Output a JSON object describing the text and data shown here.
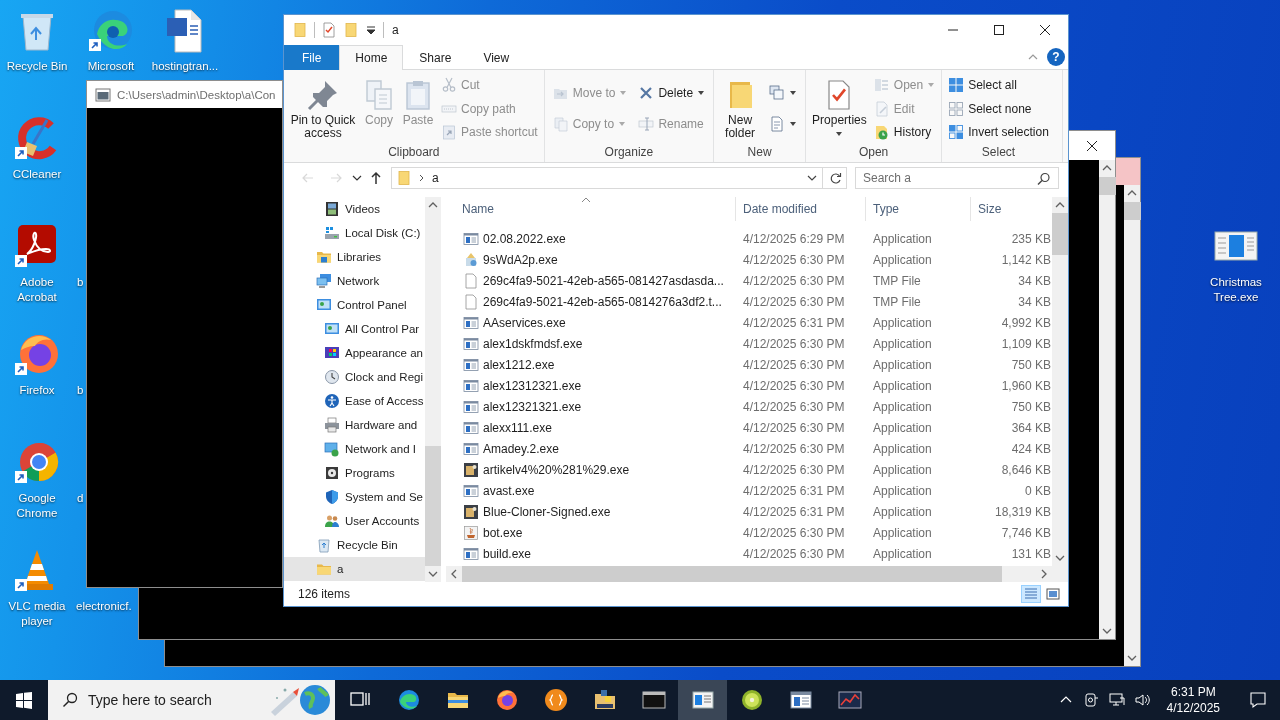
{
  "desktop_icons": [
    {
      "label": "Recycle Bin",
      "kind": "recycle-bin",
      "shortcut": false
    },
    {
      "label": "Microsoft",
      "kind": "edge",
      "shortcut": true
    },
    {
      "label": "hostingtran...",
      "kind": "document",
      "shortcut": false
    },
    {
      "label": "CCleaner",
      "kind": "cleaner",
      "shortcut": true
    },
    {
      "label": "Adobe Acrobat",
      "kind": "acrobat",
      "shortcut": true
    },
    {
      "label": "b",
      "kind": "hidden"
    },
    {
      "label": "Firefox",
      "kind": "firefox",
      "shortcut": true
    },
    {
      "label": "b",
      "kind": "hidden"
    },
    {
      "label": "Google Chrome",
      "kind": "chrome",
      "shortcut": true
    },
    {
      "label": "d",
      "kind": "hidden"
    },
    {
      "label": "VLC media player",
      "kind": "vlc",
      "shortcut": true
    },
    {
      "label": "electronicf.",
      "kind": "hidden"
    },
    {
      "label": "Christmas Tree.exe",
      "kind": "app-window",
      "shortcut": false
    }
  ],
  "console_windows": [
    {
      "kind": "titled",
      "title": "C:\\Users\\admin\\Desktop\\a\\Con"
    },
    {
      "kind": "closable"
    },
    {
      "kind": "tinted"
    }
  ],
  "explorer": {
    "title": "a",
    "help": "?",
    "ribbon_tabs": [
      {
        "label": "File",
        "kind": "file",
        "selected": false
      },
      {
        "label": "Home",
        "kind": "tab",
        "selected": true
      },
      {
        "label": "Share",
        "kind": "tab",
        "selected": false
      },
      {
        "label": "View",
        "kind": "tab",
        "selected": false
      }
    ],
    "ribbon_groups": [
      {
        "label": "Clipboard",
        "columns": [
          {
            "kind": "large",
            "commands": [
              {
                "kind": "pin",
                "label": "Pin to Quick access",
                "disabled": false,
                "dropdown": false
              }
            ]
          },
          {
            "kind": "large",
            "commands": [
              {
                "kind": "copy",
                "label": "Copy",
                "disabled": true,
                "dropdown": false
              }
            ]
          },
          {
            "kind": "large",
            "commands": [
              {
                "kind": "paste",
                "label": "Paste",
                "disabled": true,
                "dropdown": false
              }
            ]
          },
          {
            "kind": "stack",
            "commands": [
              {
                "kind": "cut",
                "label": "Cut",
                "disabled": true,
                "dropdown": false
              },
              {
                "kind": "copy-path",
                "label": "Copy path",
                "disabled": true,
                "dropdown": false
              },
              {
                "kind": "paste-shortcut",
                "label": "Paste shortcut",
                "disabled": true,
                "dropdown": false
              }
            ]
          }
        ]
      },
      {
        "label": "Organize",
        "columns": [
          {
            "kind": "stack",
            "commands": [
              {
                "kind": "move-to",
                "label": "Move to",
                "disabled": true,
                "dropdown": true
              },
              {
                "kind": "copy-to",
                "label": "Copy to",
                "disabled": true,
                "dropdown": true
              }
            ]
          },
          {
            "kind": "stack",
            "commands": [
              {
                "kind": "delete",
                "label": "Delete",
                "disabled": false,
                "dropdown": true
              },
              {
                "kind": "rename",
                "label": "Rename",
                "disabled": true,
                "dropdown": false
              }
            ]
          }
        ]
      },
      {
        "label": "New",
        "columns": [
          {
            "kind": "large",
            "commands": [
              {
                "kind": "new-folder",
                "label": "New folder",
                "disabled": false,
                "dropdown": false
              }
            ]
          },
          {
            "kind": "stack",
            "commands": [
              {
                "kind": "new-item",
                "disabled": false,
                "dropdown": true
              },
              {
                "kind": "easy-access",
                "disabled": false,
                "dropdown": true
              }
            ]
          }
        ]
      },
      {
        "label": "Open",
        "columns": [
          {
            "kind": "large",
            "commands": [
              {
                "kind": "properties",
                "label": "Properties",
                "disabled": false,
                "dropdown": true
              }
            ]
          },
          {
            "kind": "stack",
            "commands": [
              {
                "kind": "open",
                "label": "Open",
                "disabled": true,
                "dropdown": true
              },
              {
                "kind": "edit",
                "label": "Edit",
                "disabled": true,
                "dropdown": false
              },
              {
                "kind": "history",
                "label": "History",
                "disabled": false,
                "dropdown": false
              }
            ]
          }
        ]
      },
      {
        "label": "Select",
        "columns": [
          {
            "kind": "stack",
            "commands": [
              {
                "kind": "select-all",
                "label": "Select all",
                "disabled": false,
                "dropdown": false
              },
              {
                "kind": "select-none",
                "label": "Select none",
                "disabled": false,
                "dropdown": false
              },
              {
                "kind": "invert-selection",
                "label": "Invert selection",
                "disabled": false,
                "dropdown": false
              }
            ]
          }
        ]
      }
    ],
    "nav_buttons": [
      {
        "kind": "back",
        "disabled": true
      },
      {
        "kind": "forward",
        "disabled": true
      },
      {
        "kind": "recent",
        "disabled": false
      },
      {
        "kind": "up",
        "disabled": false
      }
    ],
    "path": [
      "a"
    ],
    "search": {
      "placeholder": "Search a"
    },
    "navigation": [
      {
        "children": [
          {
            "label": "Videos",
            "kind": "videos",
            "selected": false
          },
          {
            "label": "Local Disk (C:)",
            "kind": "disk",
            "selected": false
          }
        ]
      },
      {
        "label": "Libraries",
        "kind": "libraries",
        "selected": false
      },
      {
        "label": "Network",
        "kind": "network",
        "selected": false
      },
      {
        "label": "Control Panel",
        "kind": "control-panel",
        "selected": false,
        "children": [
          {
            "label": "All Control Par",
            "kind": "control-panel",
            "selected": false
          },
          {
            "label": "Appearance an",
            "kind": "appearance",
            "selected": false
          },
          {
            "label": "Clock and Regi",
            "kind": "clock",
            "selected": false
          },
          {
            "label": "Ease of Access",
            "kind": "ease",
            "selected": false
          },
          {
            "label": "Hardware and",
            "kind": "hardware",
            "selected": false
          },
          {
            "label": "Network and I",
            "kind": "network-internet",
            "selected": false
          },
          {
            "label": "Programs",
            "kind": "programs",
            "selected": false
          },
          {
            "label": "System and Se",
            "kind": "system",
            "selected": false
          },
          {
            "label": "User Accounts",
            "kind": "users",
            "selected": false
          }
        ]
      },
      {
        "label": "Recycle Bin",
        "kind": "recycle",
        "selected": false
      },
      {
        "label": "a",
        "kind": "folder",
        "selected": true
      }
    ],
    "file_list": {
      "columns": [
        {
          "label": "Name",
          "sorted": true
        },
        {
          "label": "Date modified"
        },
        {
          "label": "Type"
        },
        {
          "label": "Size"
        }
      ],
      "rows": [
        {
          "name": "02.08.2022.exe",
          "date": "4/12/2025 6:29 PM",
          "type": "Application",
          "size": "235 KB",
          "kind": "app",
          "selected": false
        },
        {
          "name": "9sWdA2p.exe",
          "date": "4/12/2025 6:30 PM",
          "type": "Application",
          "size": "1,142 KB",
          "kind": "setup",
          "selected": false
        },
        {
          "name": "269c4fa9-5021-42eb-a565-081427asdasda...",
          "date": "4/12/2025 6:30 PM",
          "type": "TMP File",
          "size": "34 KB",
          "kind": "file",
          "selected": false
        },
        {
          "name": "269c4fa9-5021-42eb-a565-0814276a3df2.t...",
          "date": "4/12/2025 6:30 PM",
          "type": "TMP File",
          "size": "34 KB",
          "kind": "file",
          "selected": false
        },
        {
          "name": "AAservices.exe",
          "date": "4/12/2025 6:31 PM",
          "type": "Application",
          "size": "4,992 KB",
          "kind": "app",
          "selected": false
        },
        {
          "name": "alex1dskfmdsf.exe",
          "date": "4/12/2025 6:30 PM",
          "type": "Application",
          "size": "1,109 KB",
          "kind": "app",
          "selected": false
        },
        {
          "name": "alex1212.exe",
          "date": "4/12/2025 6:30 PM",
          "type": "Application",
          "size": "750 KB",
          "kind": "app",
          "selected": false
        },
        {
          "name": "alex12312321.exe",
          "date": "4/12/2025 6:30 PM",
          "type": "Application",
          "size": "1,960 KB",
          "kind": "app",
          "selected": false
        },
        {
          "name": "alex12321321.exe",
          "date": "4/12/2025 6:30 PM",
          "type": "Application",
          "size": "750 KB",
          "kind": "app",
          "selected": false
        },
        {
          "name": "alexx111.exe",
          "date": "4/12/2025 6:30 PM",
          "type": "Application",
          "size": "364 KB",
          "kind": "app",
          "selected": false
        },
        {
          "name": "Amadey.2.exe",
          "date": "4/12/2025 6:30 PM",
          "type": "Application",
          "size": "424 KB",
          "kind": "app",
          "selected": false
        },
        {
          "name": "artikelv4%20%281%29.exe",
          "date": "4/12/2025 6:30 PM",
          "type": "Application",
          "size": "8,646 KB",
          "kind": "image",
          "selected": false
        },
        {
          "name": "avast.exe",
          "date": "4/12/2025 6:31 PM",
          "type": "Application",
          "size": "0 KB",
          "kind": "app",
          "selected": false
        },
        {
          "name": "Blue-Cloner-Signed.exe",
          "date": "4/12/2025 6:31 PM",
          "type": "Application",
          "size": "18,319 KB",
          "kind": "image",
          "selected": false
        },
        {
          "name": "bot.exe",
          "date": "4/12/2025 6:30 PM",
          "type": "Application",
          "size": "7,746 KB",
          "kind": "cup",
          "selected": false
        },
        {
          "name": "build.exe",
          "date": "4/12/2025 6:30 PM",
          "type": "Application",
          "size": "131 KB",
          "kind": "app",
          "selected": false
        }
      ]
    },
    "status": {
      "item_count": "126 items",
      "views": [
        {
          "kind": "details",
          "selected": true
        },
        {
          "kind": "large-icons",
          "selected": false
        }
      ]
    }
  },
  "taskbar": {
    "search_placeholder": "Type here to search",
    "apps": [
      {
        "kind": "task-view",
        "selected": false
      },
      {
        "kind": "edge",
        "selected": false
      },
      {
        "kind": "file-explorer",
        "selected": false
      },
      {
        "kind": "firefox",
        "selected": false
      },
      {
        "kind": "orange-app",
        "selected": false
      },
      {
        "kind": "python-app",
        "selected": false
      },
      {
        "kind": "console",
        "selected": false
      },
      {
        "kind": "window-app",
        "selected": true
      },
      {
        "kind": "kiwi",
        "selected": false
      },
      {
        "kind": "blue-window-app",
        "selected": false
      },
      {
        "kind": "chart-app",
        "selected": false
      }
    ],
    "time": "6:31 PM",
    "date": "4/12/2025"
  }
}
